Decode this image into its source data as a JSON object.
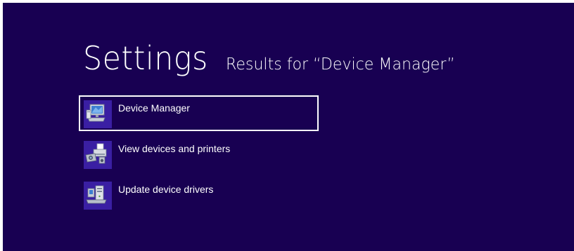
{
  "header": {
    "title": "Settings",
    "subtitle": "Results for “Device Manager”"
  },
  "results": [
    {
      "label": "Device Manager",
      "icon": "device-manager-icon",
      "selected": true
    },
    {
      "label": "View devices and printers",
      "icon": "devices-printers-icon",
      "selected": false
    },
    {
      "label": "Update device drivers",
      "icon": "device-drivers-icon",
      "selected": false
    }
  ],
  "colors": {
    "background": "#180052",
    "tile": "#3a1fa3",
    "text": "#ffffff",
    "selection_border": "#ffffff"
  }
}
